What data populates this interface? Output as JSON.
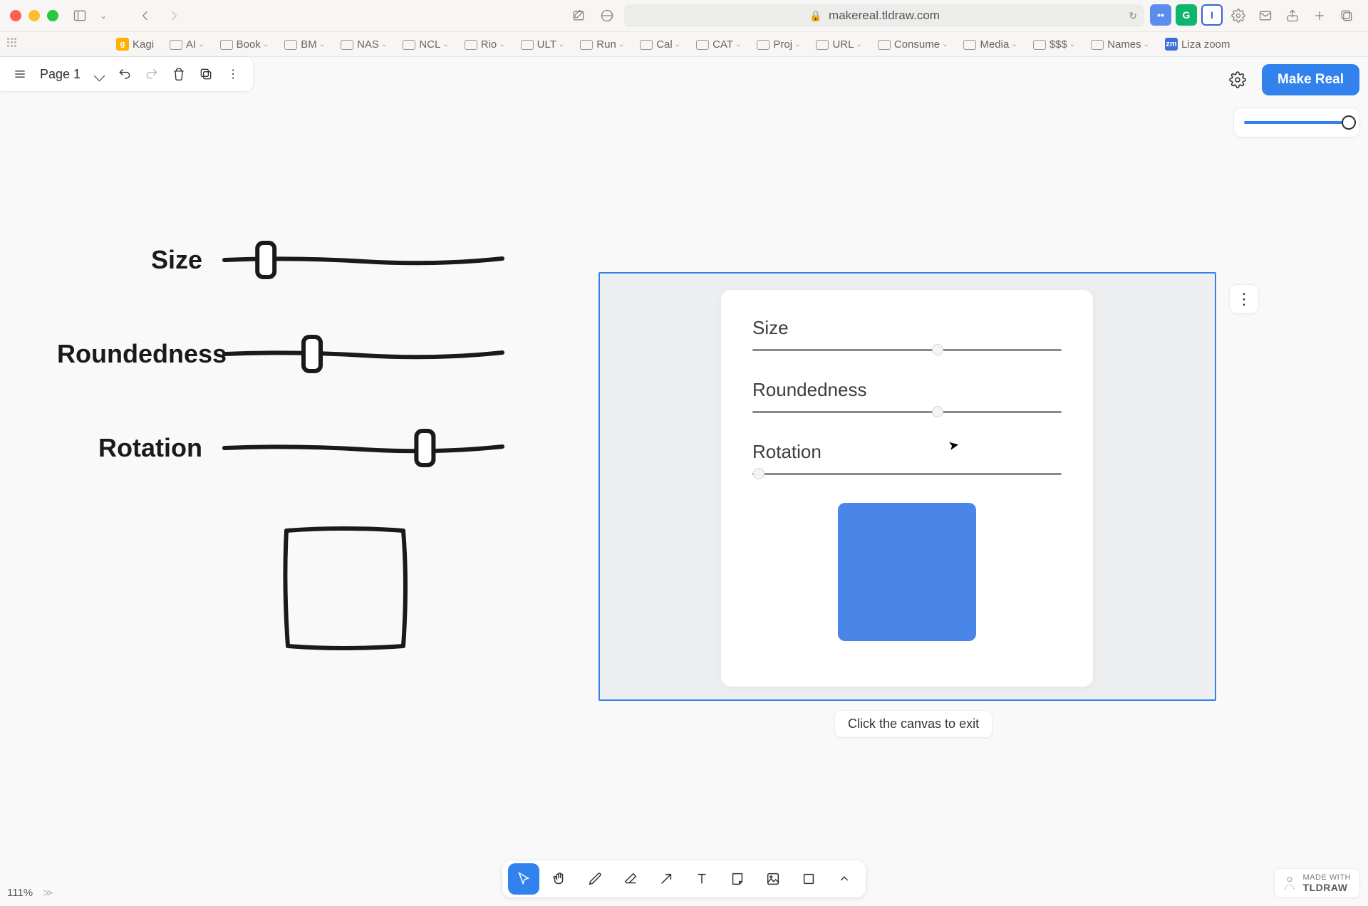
{
  "browser": {
    "url": "makereal.tldraw.com",
    "bookmarks": [
      {
        "label": "Kagi",
        "type": "favicon",
        "color": "#ffb000",
        "letter": "g"
      },
      {
        "label": "AI",
        "type": "folder"
      },
      {
        "label": "Book",
        "type": "folder"
      },
      {
        "label": "BM",
        "type": "folder"
      },
      {
        "label": "NAS",
        "type": "folder"
      },
      {
        "label": "NCL",
        "type": "folder"
      },
      {
        "label": "Rio",
        "type": "folder"
      },
      {
        "label": "ULT",
        "type": "folder"
      },
      {
        "label": "Run",
        "type": "folder"
      },
      {
        "label": "Cal",
        "type": "folder"
      },
      {
        "label": "CAT",
        "type": "folder"
      },
      {
        "label": "Proj",
        "type": "folder"
      },
      {
        "label": "URL",
        "type": "folder"
      },
      {
        "label": "Consume",
        "type": "folder"
      },
      {
        "label": "Media",
        "type": "folder"
      },
      {
        "label": "$$$",
        "type": "folder"
      },
      {
        "label": "Names",
        "type": "folder"
      },
      {
        "label": "Liza zoom",
        "type": "favicon",
        "color": "#3a70d8",
        "letter": "zm"
      }
    ]
  },
  "topbar": {
    "page": "Page 1"
  },
  "tr": {
    "make_real": "Make Real"
  },
  "sketch": {
    "rows": [
      {
        "label": "Size",
        "thumb": 0.12
      },
      {
        "label": "Roundedness",
        "thumb": 0.3
      },
      {
        "label": "Rotation",
        "thumb": 0.74
      }
    ]
  },
  "generated": {
    "controls": [
      {
        "label": "Size",
        "value": 0.6
      },
      {
        "label": "Roundedness",
        "value": 0.6
      },
      {
        "label": "Rotation",
        "value": 0.02
      }
    ],
    "exit_tip": "Click the canvas to exit"
  },
  "zoom": {
    "level": "111%"
  },
  "badge": {
    "line1": "MADE WITH",
    "brand": "TLDRAW"
  }
}
